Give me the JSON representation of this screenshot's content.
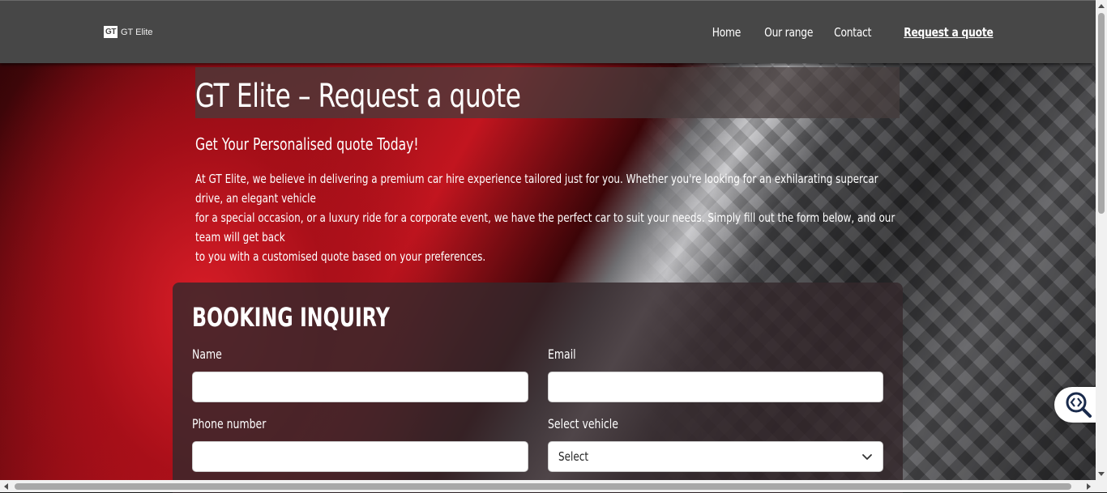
{
  "header": {
    "logo_mark": "GT",
    "logo_text": "GT Elite",
    "nav": [
      "Home",
      "Our range",
      "Contact",
      "Request a quote"
    ],
    "active_nav": "Request a quote"
  },
  "hero": {
    "title": "GT Elite – Request a quote",
    "subtitle": "Get Your Personalised quote Today!",
    "intro_line1": "At GT Elite, we believe in delivering a premium car hire experience tailored just for you. Whether you're looking for an exhilarating supercar drive, an elegant vehicle",
    "intro_line2": "for a special occasion, or a luxury ride for a corporate event, we have the perfect car to suit your needs. Simply fill out the form below, and our team will get back",
    "intro_line3": "to you with a customised quote based on your preferences."
  },
  "form": {
    "title": "BOOKING INQUIRY",
    "name_label": "Name",
    "name_value": "",
    "email_label": "Email",
    "email_value": "",
    "phone_label": "Phone number",
    "phone_value": "",
    "vehicle_label": "Select vehicle",
    "vehicle_selected": "Select"
  },
  "icons": {
    "chevron": "chevron-down-icon",
    "accessibility": "code-search-icon"
  }
}
